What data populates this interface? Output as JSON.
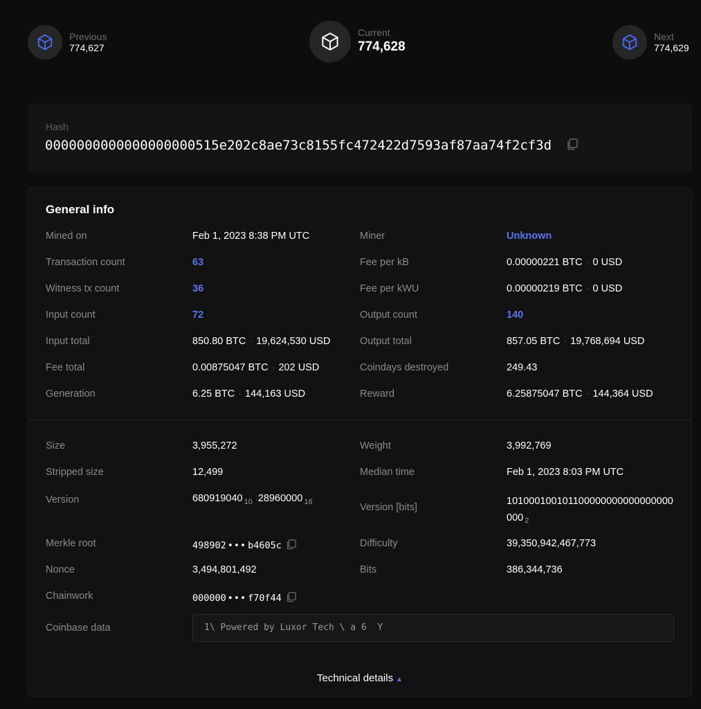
{
  "nav": {
    "previous": {
      "caption": "Previous",
      "number": "774,627"
    },
    "current": {
      "caption": "Current",
      "number": "774,628"
    },
    "next": {
      "caption": "Next",
      "number": "774,629"
    }
  },
  "hash": {
    "label": "Hash",
    "value": "0000000000000000000515e202c8ae73c8155fc472422d7593af87aa74f2cf3d"
  },
  "general_info": {
    "title": "General info",
    "left": [
      {
        "label": "Mined on",
        "value": "Feb 1, 2023 8:38 PM UTC"
      },
      {
        "label": "Transaction count",
        "value": "63"
      },
      {
        "label": "Witness tx count",
        "value": "36"
      },
      {
        "label": "Input count",
        "value": "72"
      },
      {
        "label": "Input total",
        "value_a": "850.80 BTC",
        "value_b": "19,624,530 USD"
      },
      {
        "label": "Fee total",
        "value_a": "0.00875047 BTC",
        "value_b": "202 USD"
      },
      {
        "label": "Generation",
        "value_a": "6.25 BTC",
        "value_b": "144,163 USD"
      }
    ],
    "right": [
      {
        "label": "Miner",
        "value": "Unknown"
      },
      {
        "label": "Fee per kB",
        "value_a": "0.00000221 BTC",
        "value_b": "0 USD"
      },
      {
        "label": "Fee per kWU",
        "value_a": "0.00000219 BTC",
        "value_b": "0 USD"
      },
      {
        "label": "Output count",
        "value": "140"
      },
      {
        "label": "Output total",
        "value_a": "857.05 BTC",
        "value_b": "19,768,694 USD"
      },
      {
        "label": "Coindays destroyed",
        "value": "249.43"
      },
      {
        "label": "Reward",
        "value_a": "6.25875047 BTC",
        "value_b": "144,364 USD"
      }
    ]
  },
  "technical": {
    "size": {
      "label": "Size",
      "value": "3,955,272"
    },
    "weight": {
      "label": "Weight",
      "value": "3,992,769"
    },
    "stripped_size": {
      "label": "Stripped size",
      "value": "12,499"
    },
    "median_time": {
      "label": "Median time",
      "value": "Feb 1, 2023 8:03 PM UTC"
    },
    "version": {
      "label": "Version",
      "decimal": "680919040",
      "decimal_base": "10",
      "hex": "28960000",
      "hex_base": "16"
    },
    "version_bits": {
      "label": "Version [bits]",
      "line1": "101000100101100000000000000000",
      "line2": "000",
      "base": "2"
    },
    "merkle_root": {
      "label": "Merkle root",
      "start": "498902",
      "dots": "•••",
      "end": "b4605c"
    },
    "difficulty": {
      "label": "Difficulty",
      "value": "39,350,942,467,773"
    },
    "nonce": {
      "label": "Nonce",
      "value": "3,494,801,492"
    },
    "bits": {
      "label": "Bits",
      "value": "386,344,736"
    },
    "chainwork": {
      "label": "Chainwork",
      "start": "000000",
      "dots": "•••",
      "end": "f70f44"
    },
    "coinbase": {
      "label": "Coinbase data",
      "value": "1\\ Powered by Luxor Tech \\ a 6  Y"
    },
    "details_label": "Technical details"
  },
  "colors": {
    "accent": "#5b74f0",
    "background": "#0d0d0d",
    "card": "#121212"
  }
}
